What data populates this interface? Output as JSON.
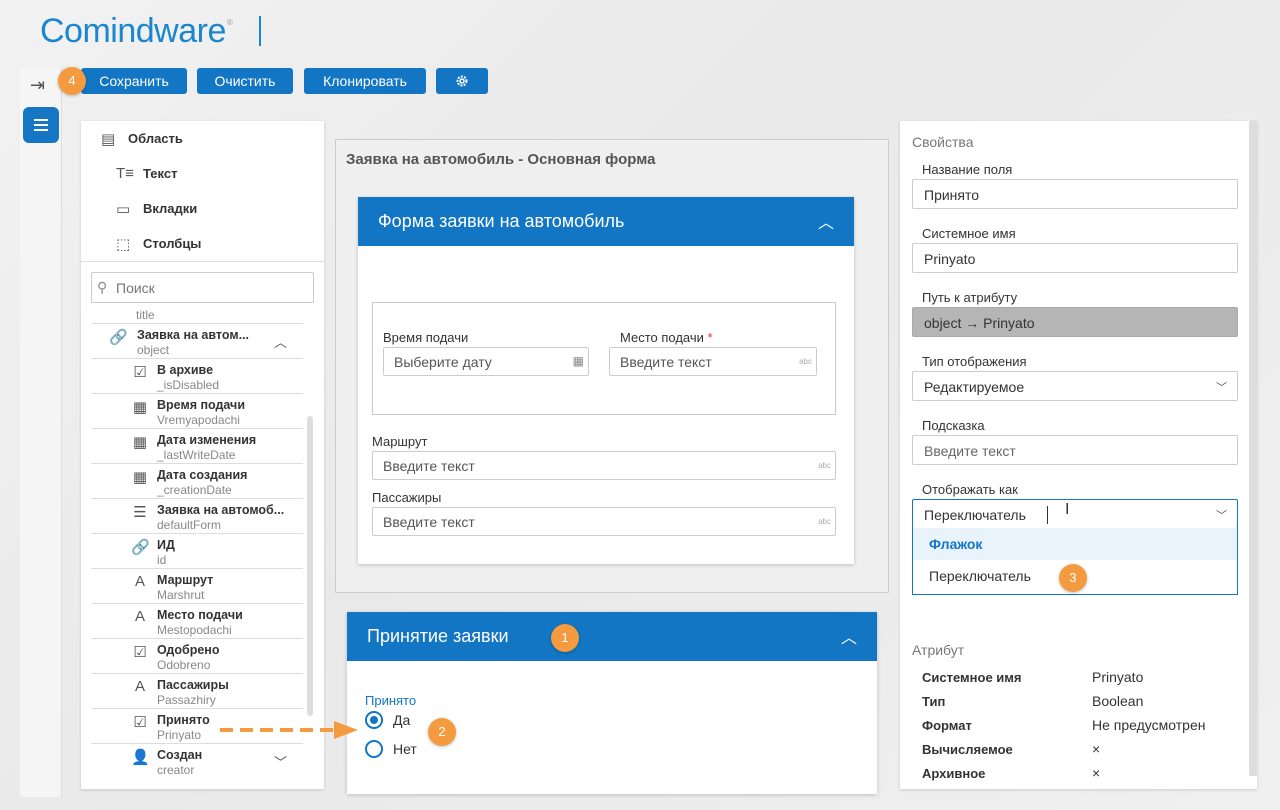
{
  "brand": {
    "logo": "Comindware",
    "reg": "®"
  },
  "toolbar": {
    "save": "Сохранить",
    "clear": "Очистить",
    "clone": "Клонировать",
    "settings_icon": "gear-icon"
  },
  "callouts": {
    "c1": "1",
    "c2": "2",
    "c3": "3",
    "c4": "4"
  },
  "controls": [
    {
      "label": "Область",
      "icon": "area-icon"
    },
    {
      "label": "Текст",
      "icon": "text-icon"
    },
    {
      "label": "Вкладки",
      "icon": "tabs-icon"
    },
    {
      "label": "Столбцы",
      "icon": "columns-icon"
    }
  ],
  "search": {
    "placeholder": "Поиск"
  },
  "tree": {
    "partial": "title",
    "group": {
      "title": "Заявка на автом...",
      "sub": "object"
    },
    "rows": [
      {
        "title": "В архиве",
        "sub": "_isDisabled",
        "icon": "☑"
      },
      {
        "title": "Время подачи",
        "sub": "Vremyapodachi",
        "icon": "▦"
      },
      {
        "title": "Дата изменения",
        "sub": "_lastWriteDate",
        "icon": "▦"
      },
      {
        "title": "Дата создания",
        "sub": "_creationDate",
        "icon": "▦"
      },
      {
        "title": "Заявка на автомоб...",
        "sub": "defaultForm",
        "icon": "☰"
      },
      {
        "title": "ИД",
        "sub": "id",
        "icon": "🔗"
      },
      {
        "title": "Маршрут",
        "sub": "Marshrut",
        "icon": "A"
      },
      {
        "title": "Место подачи",
        "sub": "Mestopodachi",
        "icon": "A"
      },
      {
        "title": "Одобрено",
        "sub": "Odobreno",
        "icon": "☑"
      },
      {
        "title": "Пассажиры",
        "sub": "Passazhiry",
        "icon": "A"
      },
      {
        "title": "Принято",
        "sub": "Prinyato",
        "icon": "☑"
      },
      {
        "title": "Создан",
        "sub": "creator",
        "icon": "👤"
      }
    ]
  },
  "form": {
    "title": "Заявка на автомобиль - Основная форма",
    "card1": {
      "header": "Форма заявки на автомобиль",
      "time_label": "Время подачи",
      "time_placeholder": "Выберите дату",
      "place_label": "Место подачи",
      "place_placeholder": "Введите текст",
      "route_label": "Маршрут",
      "route_placeholder": "Введите текст",
      "pass_label": "Пассажиры",
      "pass_placeholder": "Введите текст",
      "abc": "abc",
      "req": "*"
    },
    "card2": {
      "header": "Принятие заявки",
      "field_label": "Принято",
      "yes": "Да",
      "no": "Нет"
    }
  },
  "props": {
    "title": "Свойства",
    "name_label": "Название поля",
    "name_value": "Принято",
    "sys_label": "Системное имя",
    "sys_value": "Prinyato",
    "path_label": "Путь к атрибуту",
    "path_value": "object → Prinyato",
    "mode_label": "Тип отображения",
    "mode_value": "Редактируемое",
    "hint_label": "Подсказка",
    "hint_placeholder": "Введите текст",
    "show_label": "Отображать как",
    "show_value": "Переключатель",
    "options": [
      "Флажок",
      "Переключатель"
    ]
  },
  "attr": {
    "title": "Атрибут",
    "rows": [
      {
        "key": "Системное имя",
        "value": "Prinyato"
      },
      {
        "key": "Тип",
        "value": "Boolean"
      },
      {
        "key": "Формат",
        "value": "Не предусмотрен"
      },
      {
        "key": "Вычисляемое",
        "value": "×"
      },
      {
        "key": "Архивное",
        "value": "×"
      }
    ]
  }
}
